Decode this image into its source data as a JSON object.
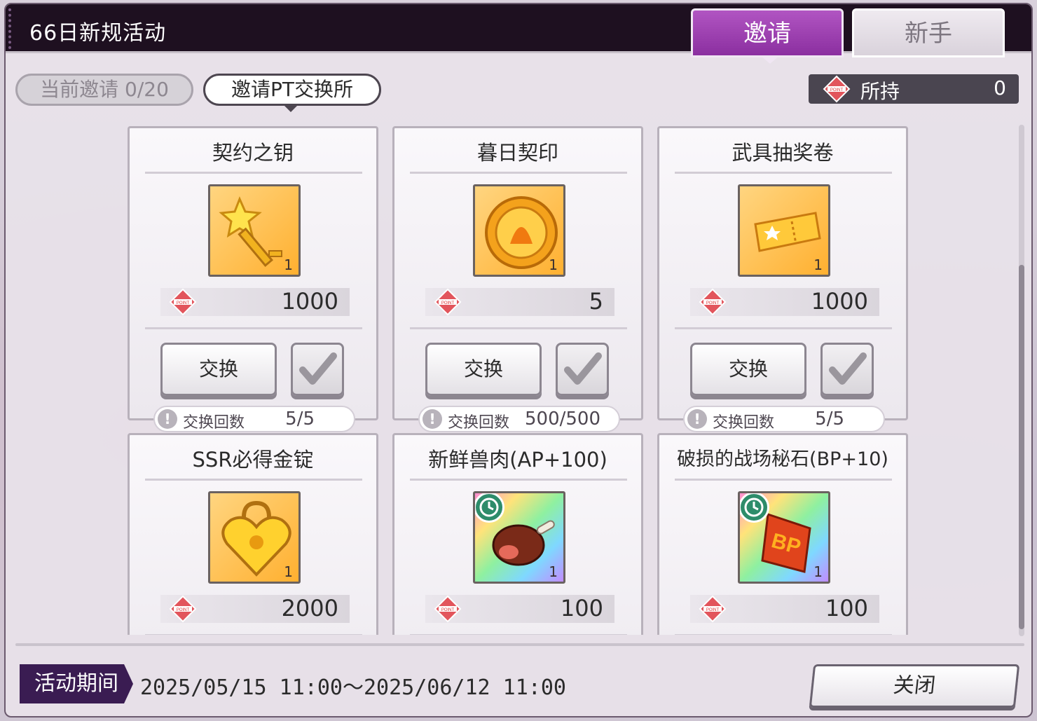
{
  "window": {
    "title": "66日新规活动",
    "tabs": [
      {
        "label": "邀请",
        "active": true
      },
      {
        "label": "新手",
        "active": false
      }
    ]
  },
  "toolbar": {
    "invite_count": "当前邀请 0/20",
    "exchange_shop": "邀请PT交换所",
    "hold_label": "所持",
    "hold_value": "0"
  },
  "items": [
    {
      "name": "契约之钥",
      "qty": "1",
      "price": "1000",
      "exchange_label": "交换",
      "count_label": "交换回数",
      "count": "5/5",
      "icon": "key-icon",
      "timed": false
    },
    {
      "name": "暮日契印",
      "qty": "1",
      "price": "5",
      "exchange_label": "交换",
      "count_label": "交换回数",
      "count": "500/500",
      "icon": "seal-icon",
      "timed": false
    },
    {
      "name": "武具抽奖卷",
      "qty": "1",
      "price": "1000",
      "exchange_label": "交换",
      "count_label": "交换回数",
      "count": "5/5",
      "icon": "ticket-icon",
      "timed": false
    },
    {
      "name": "SSR必得金锭",
      "qty": "1",
      "price": "2000",
      "icon": "heart-lock-icon",
      "timed": false
    },
    {
      "name": "新鲜兽肉(AP+100)",
      "qty": "1",
      "price": "100",
      "icon": "meat-icon",
      "timed": true
    },
    {
      "name": "破损的战场秘石(BP+10)",
      "qty": "1",
      "price": "100",
      "icon": "bp-stone-icon",
      "timed": true
    }
  ],
  "footer": {
    "period_label": "活动期间",
    "period_value": "2025/05/15 11:00～2025/06/12 11:00",
    "close_label": "关闭"
  },
  "colors": {
    "accent": "#9b3fb0",
    "title_bar": "#1e1020",
    "period_tag": "#3a1c52"
  }
}
